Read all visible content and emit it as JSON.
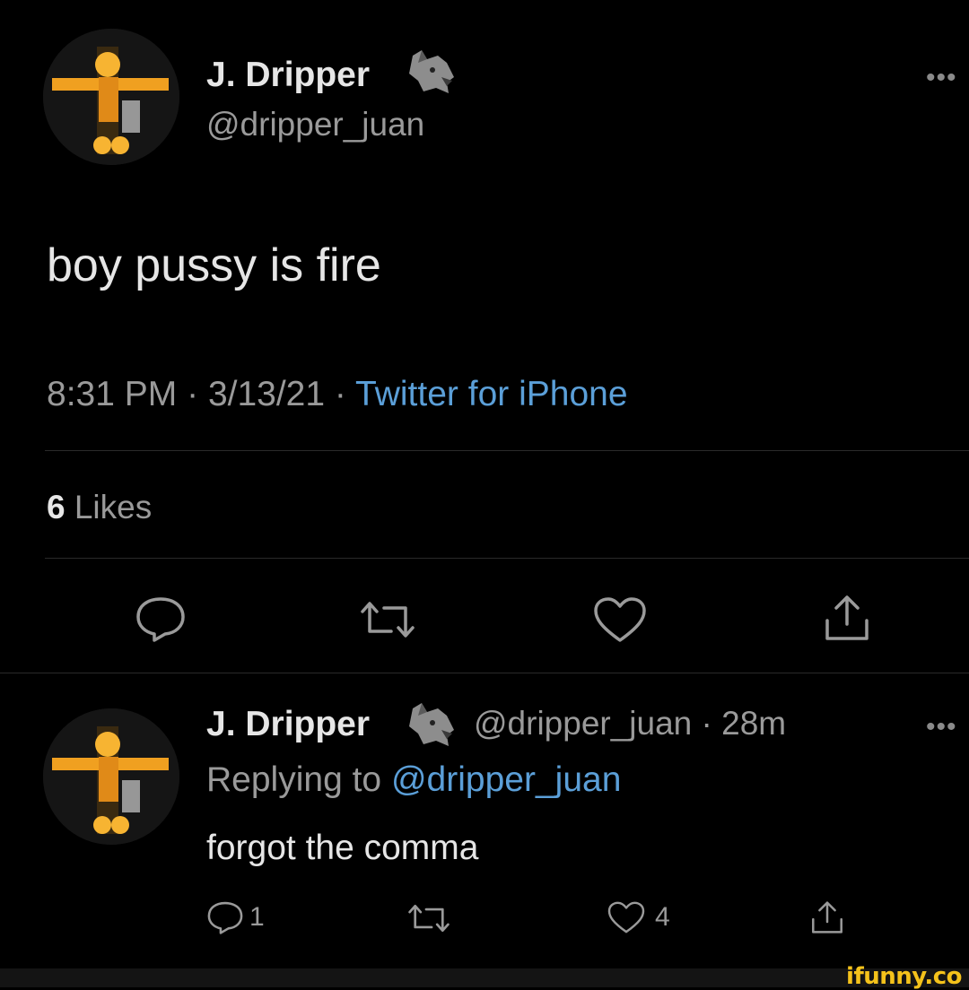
{
  "tweet": {
    "author_name": "J. Dripper",
    "author_handle": "@dripper_juan",
    "author_badge": "wolf-emoji",
    "text": "boy pussy is fire",
    "time": "8:31 PM",
    "date": "3/13/21",
    "source": "Twitter for iPhone",
    "separator": "·",
    "likes_count": "6",
    "likes_label": "Likes",
    "more_label": "•••"
  },
  "reply": {
    "author_name": "J. Dripper",
    "author_handle": "@dripper_juan",
    "age": "· 28m",
    "replying_prefix": "Replying to",
    "replying_handle": "@dripper_juan",
    "text": "forgot the comma",
    "reply_count": "1",
    "like_count": "4",
    "more_label": "•••"
  },
  "colors": {
    "background": "#000000",
    "text": "#d9d9d9",
    "muted": "#9a9a9a",
    "link": "#5b9fd8",
    "watermark": "#f4c21b"
  },
  "watermark": "ifunny.co"
}
